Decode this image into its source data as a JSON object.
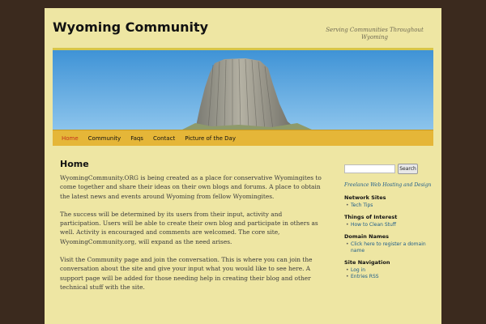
{
  "site": {
    "title": "Wyoming Community",
    "description": "Serving Communities Throughout Wyoming"
  },
  "nav": {
    "items": [
      {
        "label": "Home",
        "current": true
      },
      {
        "label": "Community",
        "current": false
      },
      {
        "label": "Faqs",
        "current": false
      },
      {
        "label": "Contact",
        "current": false
      },
      {
        "label": "Picture of the Day",
        "current": false
      }
    ]
  },
  "content": {
    "title": "Home",
    "paragraphs": [
      "WyomingCommunity.ORG is being created as a place for conservative Wyomingites to come together and share their ideas on their own blogs and forums. A place to obtain the latest news and events around Wyoming from fellow Wyomingites.",
      "The success will be determined by its users from their input, activity and participation. Users will be able to create their own blog and participate in others as well. Activity is encouraged and comments are welcomed. The core site, WyomingCommunity.org, will expand as the need arises.",
      "Visit the Community page and join the conversation. This is where you can join the conversation about the site and give your input what you would like to see here. A support page will be added for those needing help in creating their blog and other technical stuff with the site."
    ]
  },
  "sidebar": {
    "search": {
      "placeholder": "",
      "button_label": "Search"
    },
    "freelance_link": "Freelance Web Hosting and Design",
    "widgets": [
      {
        "title": "Network Sites",
        "items": [
          "Tech Tips"
        ]
      },
      {
        "title": "Things of Interest",
        "items": [
          "How to Clean Stuff"
        ]
      },
      {
        "title": "Domain Names",
        "items": [
          "Click here to register a domain name"
        ]
      },
      {
        "title": "Site Navigation",
        "items": [
          "Log in",
          "Entries RSS"
        ]
      }
    ]
  },
  "colors": {
    "background": "#3b2a1e",
    "page": "#eee6a3",
    "nav": "#e5b638",
    "current_nav": "#c4321c",
    "link": "#1d5c8a"
  }
}
